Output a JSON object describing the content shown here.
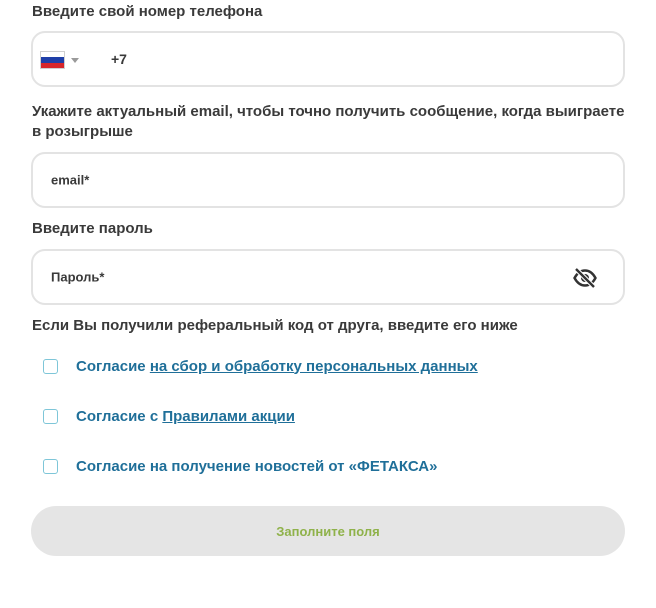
{
  "phone": {
    "label": "Введите свой номер телефона",
    "country_flag_icon": "russia-flag-icon",
    "dropdown_icon": "chevron-down-icon",
    "prefix": "+7"
  },
  "email": {
    "label": "Укажите актуальный email, чтобы точно получить сообщение, когда выиграете в розыгрыше",
    "placeholder": "email*"
  },
  "password": {
    "label": "Введите пароль",
    "placeholder": "Пароль*",
    "toggle_icon": "eye-off-icon"
  },
  "referral": {
    "text": "Если Вы получили реферальный код от друга, введите его ниже"
  },
  "consents": [
    {
      "prefix": "Согласие ",
      "link": "на сбор и обработку персональных данных",
      "checked": false
    },
    {
      "prefix": "Согласие с ",
      "link": "Правилами акции",
      "checked": false
    },
    {
      "prefix": "Согласие на получение новостей от «ФЕТАКСА»",
      "link": "",
      "checked": false
    }
  ],
  "submit": {
    "label": "Заполните поля",
    "enabled": false
  },
  "colors": {
    "label_text": "#3a3a3a",
    "field_border": "#e3e3e3",
    "link": "#1f6f99",
    "checkbox_border": "#7ec6d8",
    "button_bg": "#e5e5e5",
    "button_text": "#8fb24a"
  }
}
